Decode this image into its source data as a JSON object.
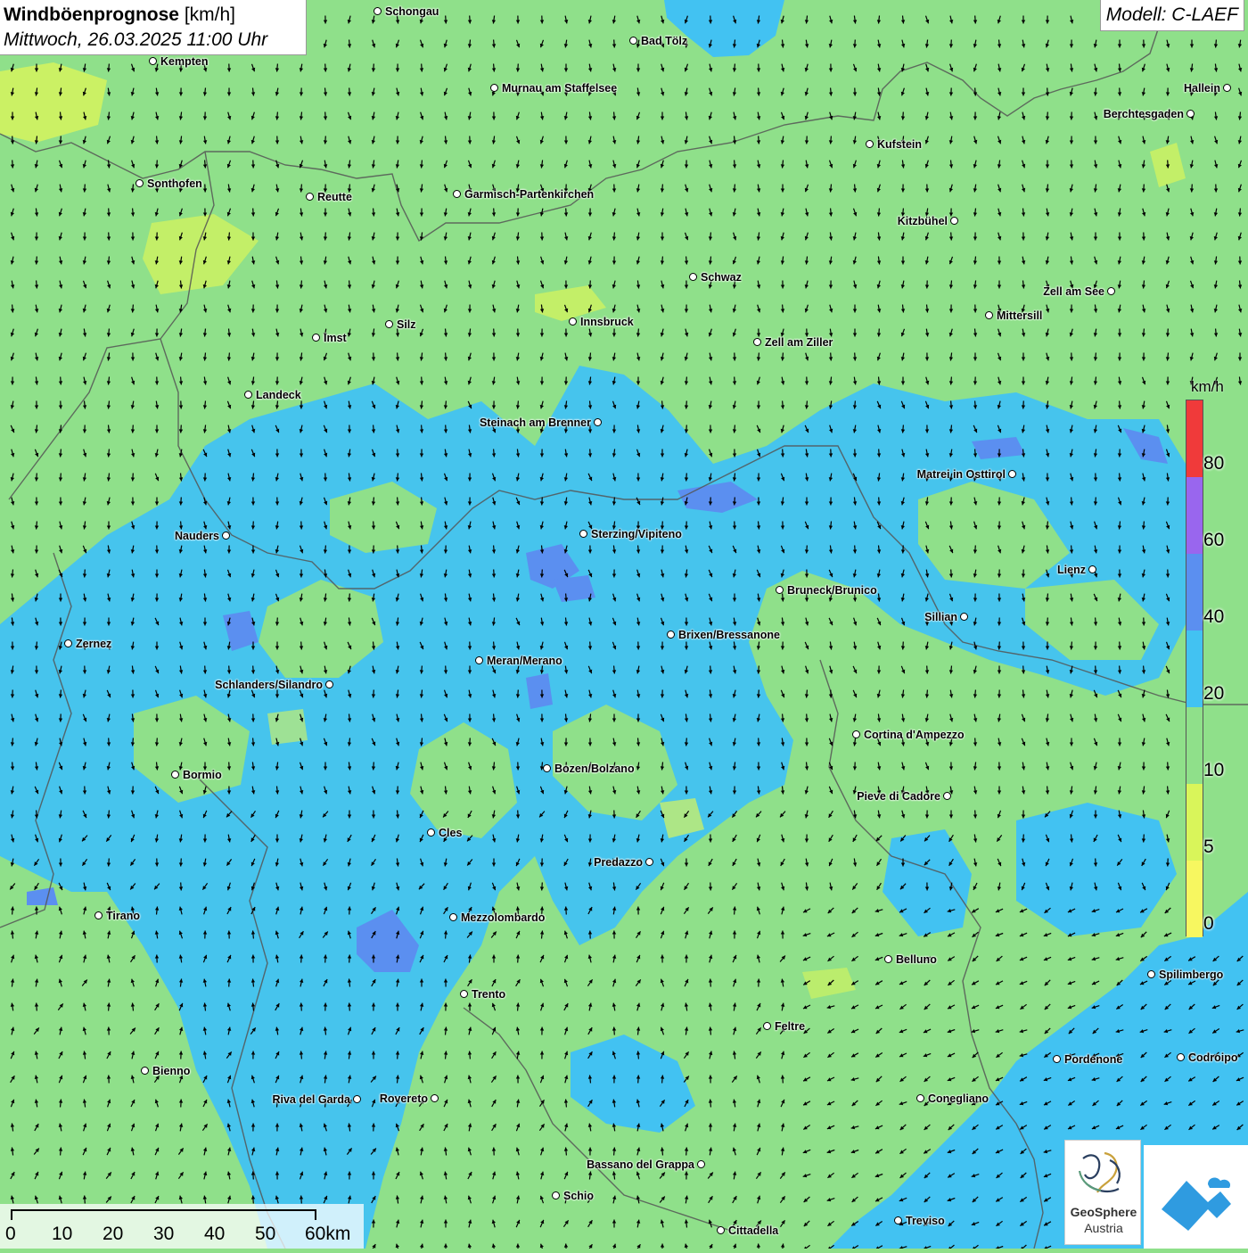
{
  "title": {
    "main": "Windböenprognose",
    "unit": "[km/h]",
    "datetime": "Mittwoch, 26.03.2025 11:00 Uhr"
  },
  "model": "Modell: C-LAEF",
  "legend": {
    "unit": "km/h",
    "ticks": [
      "80",
      "60",
      "40",
      "20",
      "10",
      "5",
      "0"
    ],
    "colors": [
      "#f03a3a",
      "#9966ee",
      "#5b8ff0",
      "#42c2f2",
      "#8fe08a",
      "#d9f55a",
      "#f7f760"
    ]
  },
  "scale": {
    "labels": [
      "0",
      "10",
      "20",
      "30",
      "40",
      "50",
      "60km"
    ]
  },
  "logos": {
    "geosphere_line1": "GeoSphere",
    "geosphere_line2": "Austria"
  },
  "cities": [
    {
      "name": "Schongau"
    },
    {
      "name": "Bad Tölz"
    },
    {
      "name": "Kempten"
    },
    {
      "name": "Murnau am Staffelsee"
    },
    {
      "name": "Hallein"
    },
    {
      "name": "Berchtesgaden"
    },
    {
      "name": "Kufstein"
    },
    {
      "name": "Sonthofen"
    },
    {
      "name": "Reutte"
    },
    {
      "name": "Garmisch-Partenkirchen"
    },
    {
      "name": "Kitzbühel"
    },
    {
      "name": "Schwaz"
    },
    {
      "name": "Zell am See"
    },
    {
      "name": "Mittersill"
    },
    {
      "name": "Innsbruck"
    },
    {
      "name": "Silz"
    },
    {
      "name": "Imst"
    },
    {
      "name": "Zell am Ziller"
    },
    {
      "name": "Landeck"
    },
    {
      "name": "Steinach am Brenner"
    },
    {
      "name": "Matrei in Osttirol"
    },
    {
      "name": "Nauders"
    },
    {
      "name": "Sterzing/Vipiteno"
    },
    {
      "name": "Lienz"
    },
    {
      "name": "Bruneck/Brunico"
    },
    {
      "name": "Sillian"
    },
    {
      "name": "Zernez"
    },
    {
      "name": "Brixen/Bressanone"
    },
    {
      "name": "Meran/Merano"
    },
    {
      "name": "Schlanders/Silandro"
    },
    {
      "name": "Cortina d'Ampezzo"
    },
    {
      "name": "Bormio"
    },
    {
      "name": "Bozen/Bolzano"
    },
    {
      "name": "Pieve di Cadore"
    },
    {
      "name": "Cles"
    },
    {
      "name": "Predazzo"
    },
    {
      "name": "Tirano"
    },
    {
      "name": "Mezzolombardo"
    },
    {
      "name": "Belluno"
    },
    {
      "name": "Spilimbergo"
    },
    {
      "name": "Trento"
    },
    {
      "name": "Feltre"
    },
    {
      "name": "Pordenone"
    },
    {
      "name": "Codroipo"
    },
    {
      "name": "Bienno"
    },
    {
      "name": "Riva del Garda"
    },
    {
      "name": "Rovereto"
    },
    {
      "name": "Conegliano"
    },
    {
      "name": "Bassano del Grappa"
    },
    {
      "name": "Schio"
    },
    {
      "name": "Treviso"
    },
    {
      "name": "Cittadella"
    }
  ]
}
